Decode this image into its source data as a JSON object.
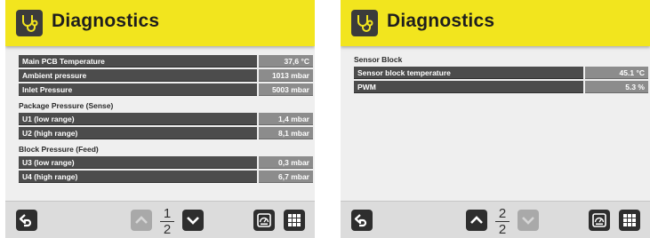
{
  "screens": [
    {
      "header": {
        "title": "Diagnostics",
        "icon": "stethoscope-icon"
      },
      "sections": [
        {
          "title": "",
          "rows": [
            {
              "label": "Main PCB Temperature",
              "value": "37,6 °C"
            },
            {
              "label": "Ambient pressure",
              "value": "1013 mbar"
            },
            {
              "label": "Inlet Pressure",
              "value": "5003 mbar"
            }
          ]
        },
        {
          "title": "Package Pressure (Sense)",
          "rows": [
            {
              "label": "U1 (low range)",
              "value": "1,4 mbar"
            },
            {
              "label": "U2 (high range)",
              "value": "8,1 mbar"
            }
          ]
        },
        {
          "title": "Block Pressure (Feed)",
          "rows": [
            {
              "label": "U3 (low range)",
              "value": "0,3 mbar"
            },
            {
              "label": "U4 (high range)",
              "value": "6,7 mbar"
            }
          ]
        }
      ],
      "footer": {
        "page_current": "1",
        "page_total": "2",
        "up_enabled": false,
        "down_enabled": true
      }
    },
    {
      "header": {
        "title": "Diagnostics",
        "icon": "stethoscope-icon"
      },
      "sections": [
        {
          "title": "Sensor Block",
          "rows": [
            {
              "label": "Sensor block temperature",
              "value": "45.1 °C"
            },
            {
              "label": "PWM",
              "value": "5.3 %"
            }
          ]
        }
      ],
      "footer": {
        "page_current": "2",
        "page_total": "2",
        "up_enabled": true,
        "down_enabled": false
      }
    }
  ],
  "colors": {
    "header": "#f2e51e",
    "row_label": "#4c4c4c",
    "row_value": "#8c8c8c",
    "button": "#2e2e2e",
    "button_disabled": "#a9a9a9"
  }
}
